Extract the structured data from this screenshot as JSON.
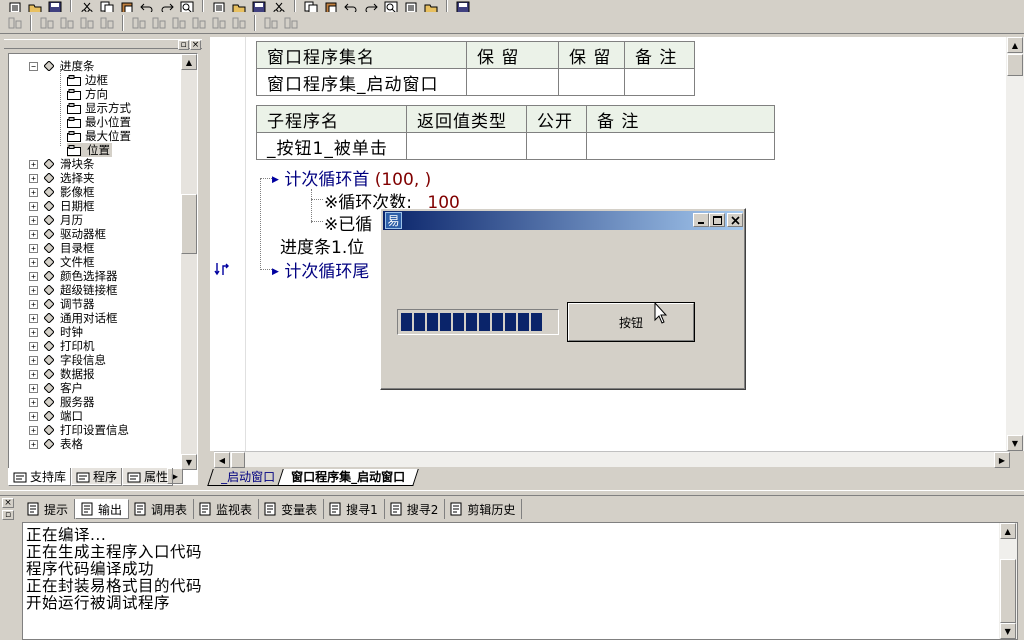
{
  "toolbar": {
    "row1_icons": [
      "new-icon",
      "open-icon",
      "save-icon",
      "cut-icon",
      "copy-icon",
      "paste-icon",
      "undo-icon",
      "redo-icon",
      "find-icon",
      "window-icon",
      "window2-icon",
      "window3-icon",
      "run-icon",
      "stop-icon",
      "step-icon",
      "step2-icon",
      "step3-icon",
      "step4-icon",
      "step5-icon",
      "hand-icon",
      "compile-icon"
    ],
    "row2_icons": [
      "align-left-icon",
      "align-center-icon",
      "align-right-icon",
      "align-top-icon",
      "align-middle-icon",
      "align-bottom-icon",
      "same-width-icon",
      "same-height-icon",
      "same-size-icon",
      "hspace-icon",
      "vspace-icon",
      "center-h-icon",
      "center-v-icon"
    ]
  },
  "tree": {
    "items": [
      {
        "label": "进度条",
        "type": "node",
        "expanded": true
      },
      {
        "label": "边框",
        "type": "prop"
      },
      {
        "label": "方向",
        "type": "prop"
      },
      {
        "label": "显示方式",
        "type": "prop"
      },
      {
        "label": "最小位置",
        "type": "prop"
      },
      {
        "label": "最大位置",
        "type": "prop"
      },
      {
        "label": "位置",
        "type": "prop",
        "selected": true
      },
      {
        "label": "滑块条",
        "type": "node"
      },
      {
        "label": "选择夹",
        "type": "node"
      },
      {
        "label": "影像框",
        "type": "node"
      },
      {
        "label": "日期框",
        "type": "node"
      },
      {
        "label": "月历",
        "type": "node"
      },
      {
        "label": "驱动器框",
        "type": "node"
      },
      {
        "label": "目录框",
        "type": "node"
      },
      {
        "label": "文件框",
        "type": "node"
      },
      {
        "label": "颜色选择器",
        "type": "node"
      },
      {
        "label": "超级链接框",
        "type": "node"
      },
      {
        "label": "调节器",
        "type": "node"
      },
      {
        "label": "通用对话框",
        "type": "node"
      },
      {
        "label": "时钟",
        "type": "node"
      },
      {
        "label": "打印机",
        "type": "node"
      },
      {
        "label": "字段信息",
        "type": "node"
      },
      {
        "label": "数据报",
        "type": "node"
      },
      {
        "label": "客户",
        "type": "node"
      },
      {
        "label": "服务器",
        "type": "node"
      },
      {
        "label": "端口",
        "type": "node"
      },
      {
        "label": "打印设置信息",
        "type": "node"
      },
      {
        "label": "表格",
        "type": "node"
      }
    ]
  },
  "left_tabs": [
    {
      "label": "支持库",
      "icon": "library-icon"
    },
    {
      "label": "程序",
      "icon": "program-icon"
    },
    {
      "label": "属性",
      "icon": "property-icon"
    }
  ],
  "editor": {
    "set_table": {
      "headers": [
        "窗口程序集名",
        "保 留",
        "保 留",
        "备 注"
      ],
      "row": [
        "窗口程序集_启动窗口",
        "",
        "",
        ""
      ]
    },
    "sub_table": {
      "headers": [
        "子程序名",
        "返回值类型",
        "公开",
        "备 注"
      ],
      "row": [
        "_按钮1_被单击",
        "",
        "",
        ""
      ]
    },
    "code": {
      "loop_head_kw": "计次循环首",
      "loop_head_args": "(100, )",
      "comment1_label": "※循环次数:",
      "comment1_value": "100",
      "comment2_label": "※已循",
      "assign_stmt": "进度条1.位",
      "loop_tail_kw": "计次循环尾"
    }
  },
  "doc_tabs": [
    "_启动窗口",
    "窗口程序集_启动窗口"
  ],
  "output_tabs": [
    {
      "label": "提示",
      "icon": "hint-icon"
    },
    {
      "label": "输出",
      "icon": "output-icon"
    },
    {
      "label": "调用表",
      "icon": "call-table-icon"
    },
    {
      "label": "监视表",
      "icon": "watch-icon"
    },
    {
      "label": "变量表",
      "icon": "variable-icon"
    },
    {
      "label": "搜寻1",
      "icon": "search-icon"
    },
    {
      "label": "搜寻2",
      "icon": "search-icon"
    },
    {
      "label": "剪辑历史",
      "icon": "clip-history-icon"
    }
  ],
  "output": {
    "lines": [
      "正在编译...",
      "正在生成主程序入口代码",
      "程序代码编译成功",
      "正在封装易格式目的代码",
      "开始运行被调试程序"
    ]
  },
  "dialog": {
    "title": "",
    "button_label": "按钮",
    "progress_blocks": 11
  },
  "colors": {
    "title_start": "#0a246a",
    "title_end": "#a6caf0",
    "keyword": "#000080",
    "number": "#800000",
    "table_header": "#ebf2e8"
  }
}
